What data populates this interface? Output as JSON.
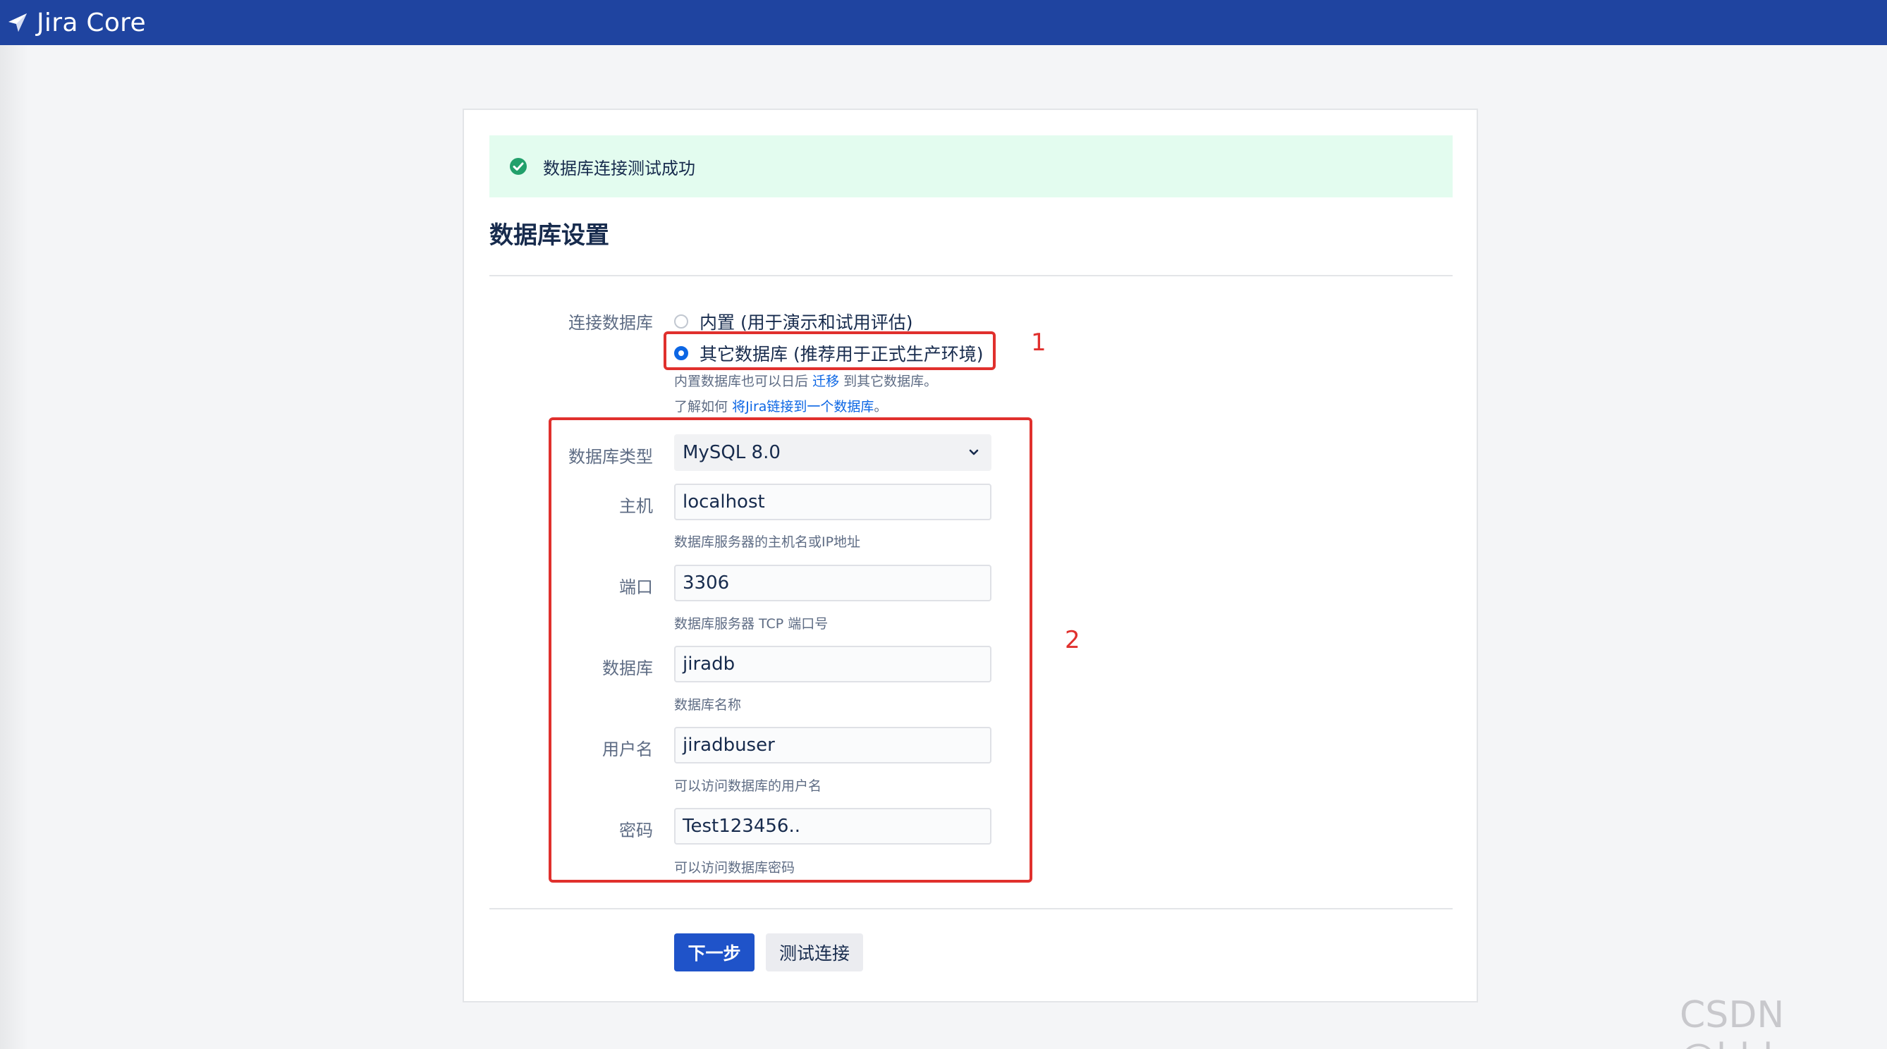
{
  "app": {
    "title": "Jira Core"
  },
  "banner": {
    "message": "数据库连接测试成功"
  },
  "page": {
    "title": "数据库设置"
  },
  "connection": {
    "label": "连接数据库",
    "options": [
      {
        "label": "内置 (用于演示和试用评估)",
        "selected": false
      },
      {
        "label": "其它数据库 (推荐用于正式生产环境)",
        "selected": true
      }
    ],
    "help1_prefix": "内置数据库也可以日后",
    "help1_link": "迁移",
    "help1_suffix": "到其它数据库。",
    "help2_prefix": "了解如何",
    "help2_link": "将Jira链接到一个数据库",
    "help2_suffix": "。"
  },
  "form": {
    "db_type": {
      "label": "数据库类型",
      "value": "MySQL 8.0"
    },
    "host": {
      "label": "主机",
      "value": "localhost",
      "help": "数据库服务器的主机名或IP地址"
    },
    "port": {
      "label": "端口",
      "value": "3306",
      "help": "数据库服务器 TCP 端口号"
    },
    "database": {
      "label": "数据库",
      "value": "jiradb",
      "help": "数据库名称"
    },
    "username": {
      "label": "用户名",
      "value": "jiradbuser",
      "help": "可以访问数据库的用户名"
    },
    "password": {
      "label": "密码",
      "value": "Test123456..",
      "help": "可以访问数据库密码"
    }
  },
  "buttons": {
    "next": "下一步",
    "test": "测试连接"
  },
  "annotations": {
    "one": "1",
    "two": "2"
  },
  "watermark": "CSDN @bhlu",
  "colors": {
    "topbar": "#1f44a0",
    "banner_bg": "#e3fcef",
    "success": "#22a06b",
    "primary": "#1f53c9",
    "annotation": "#e0302d",
    "link": "#0c66e4"
  }
}
